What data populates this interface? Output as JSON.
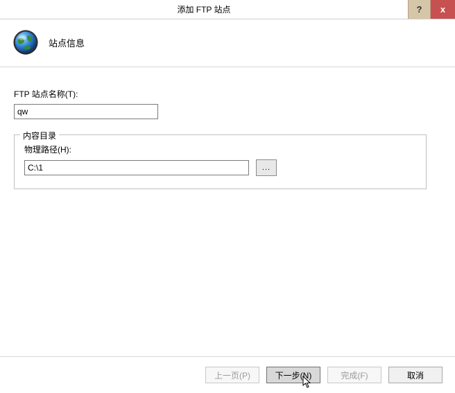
{
  "titlebar": {
    "title": "添加 FTP 站点",
    "help": "?",
    "close": "x"
  },
  "header": {
    "page_title": "站点信息"
  },
  "form": {
    "site_name_label": "FTP 站点名称(T):",
    "site_name_value": "qw",
    "content_dir_legend": "内容目录",
    "physical_path_label": "物理路径(H):",
    "physical_path_value": "C:\\1",
    "browse_label": "..."
  },
  "footer": {
    "prev": "上一页(P)",
    "next": "下一步(N)",
    "finish": "完成(F)",
    "cancel": "取消"
  }
}
